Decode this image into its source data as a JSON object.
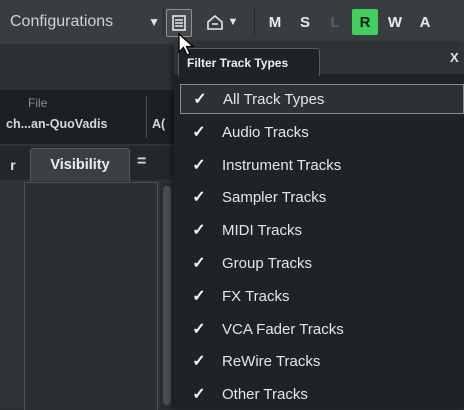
{
  "toolbar": {
    "configurations_label": "Configurations",
    "filter_icon": "list-filter-icon",
    "preset_icon": "preset-home-icon",
    "toggles": [
      {
        "label": "M",
        "state": "normal"
      },
      {
        "label": "S",
        "state": "normal"
      },
      {
        "label": "L",
        "state": "dim"
      },
      {
        "label": "R",
        "state": "on"
      },
      {
        "label": "W",
        "state": "normal"
      },
      {
        "label": "A",
        "state": "normal"
      }
    ]
  },
  "info": {
    "file_label": "File",
    "file_name": "ch...an-QuoVadis",
    "file_name2": "A("
  },
  "tabs": {
    "stub_label": "r",
    "active_label": "Visibility",
    "menu_symbol": "="
  },
  "popup": {
    "tab_label": "Filter Track Types",
    "close_label": "X",
    "items": [
      {
        "label": "All Track Types",
        "checked": true,
        "selected": true
      },
      {
        "label": "Audio Tracks",
        "checked": true,
        "selected": false
      },
      {
        "label": "Instrument Tracks",
        "checked": true,
        "selected": false
      },
      {
        "label": "Sampler Tracks",
        "checked": true,
        "selected": false
      },
      {
        "label": "MIDI Tracks",
        "checked": true,
        "selected": false
      },
      {
        "label": "Group Tracks",
        "checked": true,
        "selected": false
      },
      {
        "label": "FX Tracks",
        "checked": true,
        "selected": false
      },
      {
        "label": "VCA Fader Tracks",
        "checked": true,
        "selected": false
      },
      {
        "label": "ReWire Tracks",
        "checked": true,
        "selected": false
      },
      {
        "label": "Other Tracks",
        "checked": true,
        "selected": false
      }
    ],
    "check_glyph": "✓"
  },
  "colors": {
    "accent_green": "#3fd060",
    "background": "#2b2e31"
  }
}
